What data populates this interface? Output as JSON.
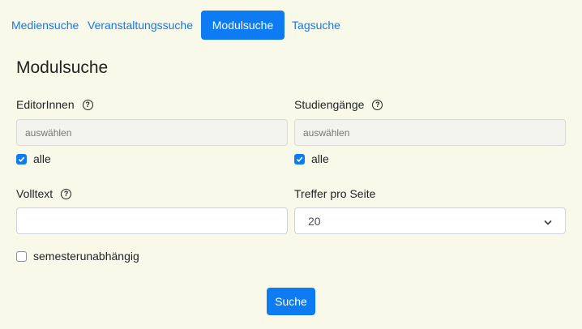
{
  "tabs": [
    {
      "label": "Mediensuche"
    },
    {
      "label": "Veranstaltungssuche"
    },
    {
      "label": "Modulsuche"
    },
    {
      "label": "Tagsuche"
    }
  ],
  "page_title": "Modulsuche",
  "editors": {
    "label": "EditorInnen",
    "placeholder": "auswählen",
    "all_label": "alle",
    "all_checked": true
  },
  "programs": {
    "label": "Studiengänge",
    "placeholder": "auswählen",
    "all_label": "alle",
    "all_checked": true
  },
  "fulltext": {
    "label": "Volltext",
    "value": ""
  },
  "per_page": {
    "label": "Treffer pro Seite",
    "selected": "20"
  },
  "semester_independent": {
    "label": "semesterunabhängig",
    "checked": false
  },
  "search_button": "Suche",
  "colors": {
    "accent": "#0d7bf2",
    "background": "#f8f9e8"
  }
}
